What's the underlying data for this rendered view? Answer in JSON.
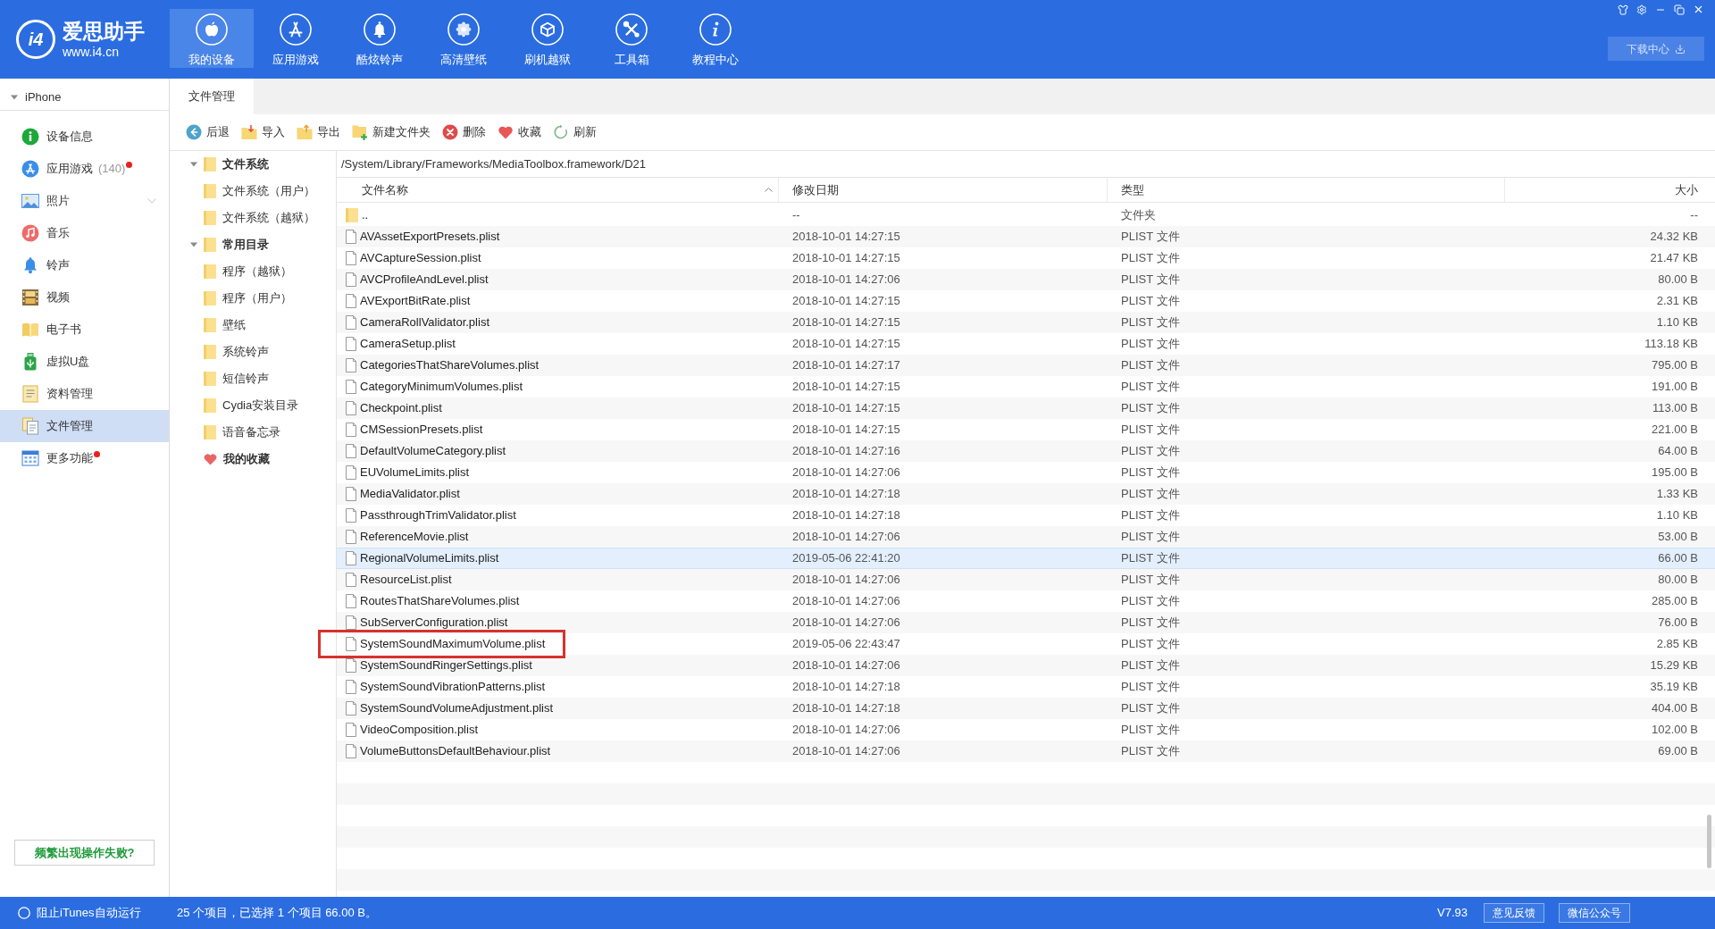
{
  "app": {
    "logo_mark": "i4",
    "name": "爱思助手",
    "url": "www.i4.cn"
  },
  "nav_tabs": [
    {
      "label": "我的设备",
      "selected": true
    },
    {
      "label": "应用游戏",
      "selected": false
    },
    {
      "label": "酷炫铃声",
      "selected": false
    },
    {
      "label": "高清壁纸",
      "selected": false
    },
    {
      "label": "刷机越狱",
      "selected": false
    },
    {
      "label": "工具箱",
      "selected": false
    },
    {
      "label": "教程中心",
      "selected": false
    }
  ],
  "download_button": {
    "label": "下载中心"
  },
  "sidebar": {
    "device": {
      "label": "iPhone",
      "expanded": true
    },
    "items": [
      {
        "label": "设备信息",
        "selected": false,
        "dot": false,
        "expandable": false
      },
      {
        "label": "应用游戏",
        "count": "(140)",
        "selected": false,
        "dot": true,
        "expandable": false
      },
      {
        "label": "照片",
        "selected": false,
        "dot": false,
        "expandable": true
      },
      {
        "label": "音乐",
        "selected": false,
        "dot": false,
        "expandable": false
      },
      {
        "label": "铃声",
        "selected": false,
        "dot": false,
        "expandable": false
      },
      {
        "label": "视频",
        "selected": false,
        "dot": false,
        "expandable": false
      },
      {
        "label": "电子书",
        "selected": false,
        "dot": false,
        "expandable": false
      },
      {
        "label": "虚拟U盘",
        "selected": false,
        "dot": false,
        "expandable": false
      },
      {
        "label": "资料管理",
        "selected": false,
        "dot": false,
        "expandable": false
      },
      {
        "label": "文件管理",
        "selected": true,
        "dot": false,
        "expandable": false
      },
      {
        "label": "更多功能",
        "selected": false,
        "dot": true,
        "expandable": false
      }
    ],
    "help_button": "频繁出现操作失败?"
  },
  "content_tabs": [
    {
      "label": "文件管理",
      "selected": true
    }
  ],
  "toolbar": [
    {
      "label": "后退"
    },
    {
      "label": "导入"
    },
    {
      "label": "导出"
    },
    {
      "label": "新建文件夹"
    },
    {
      "label": "删除"
    },
    {
      "label": "收藏"
    },
    {
      "label": "刷新"
    }
  ],
  "tree": [
    {
      "label": "文件系统",
      "kind": "folder",
      "expanded": true,
      "children": [
        {
          "label": "文件系统（用户）",
          "kind": "folder"
        },
        {
          "label": "文件系统（越狱）",
          "kind": "folder"
        }
      ]
    },
    {
      "label": "常用目录",
      "kind": "folder",
      "expanded": true,
      "children": [
        {
          "label": "程序（越狱）",
          "kind": "folder"
        },
        {
          "label": "程序（用户）",
          "kind": "folder"
        },
        {
          "label": "壁纸",
          "kind": "folder"
        },
        {
          "label": "系统铃声",
          "kind": "folder"
        },
        {
          "label": "短信铃声",
          "kind": "folder"
        },
        {
          "label": "Cydia安装目录",
          "kind": "folder"
        },
        {
          "label": "语音备忘录",
          "kind": "folder"
        }
      ]
    },
    {
      "label": "我的收藏",
      "kind": "favorites"
    }
  ],
  "path": "/System/Library/Frameworks/MediaToolbox.framework/D21",
  "table": {
    "columns": [
      {
        "label": "文件名称",
        "sorted": true
      },
      {
        "label": "修改日期",
        "sorted": false
      },
      {
        "label": "类型",
        "sorted": false
      },
      {
        "label": "大小",
        "sorted": false
      }
    ],
    "rows": [
      {
        "kind": "folder",
        "name": "..",
        "date": "--",
        "type": "文件夹",
        "size": "--",
        "selected": false,
        "annotated": false
      },
      {
        "kind": "file",
        "name": "AVAssetExportPresets.plist",
        "date": "2018-10-01 14:27:15",
        "type": "PLIST 文件",
        "size": "24.32 KB",
        "selected": false,
        "annotated": false
      },
      {
        "kind": "file",
        "name": "AVCaptureSession.plist",
        "date": "2018-10-01 14:27:15",
        "type": "PLIST 文件",
        "size": "21.47 KB",
        "selected": false,
        "annotated": false
      },
      {
        "kind": "file",
        "name": "AVCProfileAndLevel.plist",
        "date": "2018-10-01 14:27:06",
        "type": "PLIST 文件",
        "size": "80.00 B",
        "selected": false,
        "annotated": false
      },
      {
        "kind": "file",
        "name": "AVExportBitRate.plist",
        "date": "2018-10-01 14:27:15",
        "type": "PLIST 文件",
        "size": "2.31 KB",
        "selected": false,
        "annotated": false
      },
      {
        "kind": "file",
        "name": "CameraRollValidator.plist",
        "date": "2018-10-01 14:27:15",
        "type": "PLIST 文件",
        "size": "1.10 KB",
        "selected": false,
        "annotated": false
      },
      {
        "kind": "file",
        "name": "CameraSetup.plist",
        "date": "2018-10-01 14:27:15",
        "type": "PLIST 文件",
        "size": "113.18 KB",
        "selected": false,
        "annotated": false
      },
      {
        "kind": "file",
        "name": "CategoriesThatShareVolumes.plist",
        "date": "2018-10-01 14:27:17",
        "type": "PLIST 文件",
        "size": "795.00 B",
        "selected": false,
        "annotated": false
      },
      {
        "kind": "file",
        "name": "CategoryMinimumVolumes.plist",
        "date": "2018-10-01 14:27:15",
        "type": "PLIST 文件",
        "size": "191.00 B",
        "selected": false,
        "annotated": false
      },
      {
        "kind": "file",
        "name": "Checkpoint.plist",
        "date": "2018-10-01 14:27:15",
        "type": "PLIST 文件",
        "size": "113.00 B",
        "selected": false,
        "annotated": false
      },
      {
        "kind": "file",
        "name": "CMSessionPresets.plist",
        "date": "2018-10-01 14:27:15",
        "type": "PLIST 文件",
        "size": "221.00 B",
        "selected": false,
        "annotated": false
      },
      {
        "kind": "file",
        "name": "DefaultVolumeCategory.plist",
        "date": "2018-10-01 14:27:16",
        "type": "PLIST 文件",
        "size": "64.00 B",
        "selected": false,
        "annotated": false
      },
      {
        "kind": "file",
        "name": "EUVolumeLimits.plist",
        "date": "2018-10-01 14:27:06",
        "type": "PLIST 文件",
        "size": "195.00 B",
        "selected": false,
        "annotated": false
      },
      {
        "kind": "file",
        "name": "MediaValidator.plist",
        "date": "2018-10-01 14:27:18",
        "type": "PLIST 文件",
        "size": "1.33 KB",
        "selected": false,
        "annotated": false
      },
      {
        "kind": "file",
        "name": "PassthroughTrimValidator.plist",
        "date": "2018-10-01 14:27:18",
        "type": "PLIST 文件",
        "size": "1.10 KB",
        "selected": false,
        "annotated": false
      },
      {
        "kind": "file",
        "name": "ReferenceMovie.plist",
        "date": "2018-10-01 14:27:06",
        "type": "PLIST 文件",
        "size": "53.00 B",
        "selected": false,
        "annotated": false
      },
      {
        "kind": "file",
        "name": "RegionalVolumeLimits.plist",
        "date": "2019-05-06 22:41:20",
        "type": "PLIST 文件",
        "size": "66.00 B",
        "selected": true,
        "annotated": false
      },
      {
        "kind": "file",
        "name": "ResourceList.plist",
        "date": "2018-10-01 14:27:06",
        "type": "PLIST 文件",
        "size": "80.00 B",
        "selected": false,
        "annotated": false
      },
      {
        "kind": "file",
        "name": "RoutesThatShareVolumes.plist",
        "date": "2018-10-01 14:27:06",
        "type": "PLIST 文件",
        "size": "285.00 B",
        "selected": false,
        "annotated": false
      },
      {
        "kind": "file",
        "name": "SubServerConfiguration.plist",
        "date": "2018-10-01 14:27:06",
        "type": "PLIST 文件",
        "size": "76.00 B",
        "selected": false,
        "annotated": false
      },
      {
        "kind": "file",
        "name": "SystemSoundMaximumVolume.plist",
        "date": "2019-05-06 22:43:47",
        "type": "PLIST 文件",
        "size": "2.85 KB",
        "selected": false,
        "annotated": true
      },
      {
        "kind": "file",
        "name": "SystemSoundRingerSettings.plist",
        "date": "2018-10-01 14:27:06",
        "type": "PLIST 文件",
        "size": "15.29 KB",
        "selected": false,
        "annotated": false
      },
      {
        "kind": "file",
        "name": "SystemSoundVibrationPatterns.plist",
        "date": "2018-10-01 14:27:18",
        "type": "PLIST 文件",
        "size": "35.19 KB",
        "selected": false,
        "annotated": false
      },
      {
        "kind": "file",
        "name": "SystemSoundVolumeAdjustment.plist",
        "date": "2018-10-01 14:27:18",
        "type": "PLIST 文件",
        "size": "404.00 B",
        "selected": false,
        "annotated": false
      },
      {
        "kind": "file",
        "name": "VideoComposition.plist",
        "date": "2018-10-01 14:27:06",
        "type": "PLIST 文件",
        "size": "102.00 B",
        "selected": false,
        "annotated": false
      },
      {
        "kind": "file",
        "name": "VolumeButtonsDefaultBehaviour.plist",
        "date": "2018-10-01 14:27:06",
        "type": "PLIST 文件",
        "size": "69.00 B",
        "selected": false,
        "annotated": false
      }
    ]
  },
  "status_bar": {
    "itunes_toggle": "阻止iTunes自动运行",
    "summary": "25 个项目，已选择 1 个项目 66.00 B。",
    "version": "V7.93",
    "buttons": [
      {
        "label": "意见反馈"
      },
      {
        "label": "微信公众号"
      }
    ]
  }
}
